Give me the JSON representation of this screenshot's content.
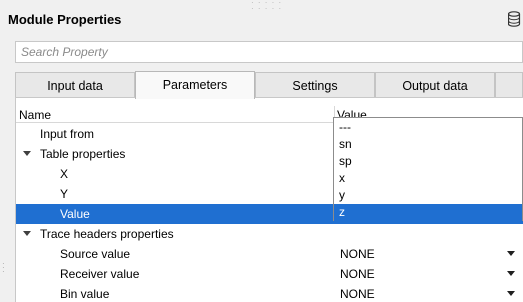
{
  "window": {
    "title": "Module Properties"
  },
  "search": {
    "placeholder": "Search Property"
  },
  "tabs": [
    {
      "label": "Input data"
    },
    {
      "label": "Parameters"
    },
    {
      "label": "Settings"
    },
    {
      "label": "Output data"
    },
    {
      "label": ""
    }
  ],
  "active_tab": "Parameters",
  "table": {
    "headers": {
      "name": "Name",
      "value": "Value"
    },
    "rows": [
      {
        "name": "Input from",
        "value": ""
      },
      {
        "name": "Table properties",
        "value": ""
      },
      {
        "name": "X",
        "value": ""
      },
      {
        "name": "Y",
        "value": ""
      },
      {
        "name": "Value",
        "value": ""
      },
      {
        "name": "Trace headers properties",
        "value": ""
      },
      {
        "name": "Source value",
        "value": "NONE"
      },
      {
        "name": "Receiver value",
        "value": "NONE"
      },
      {
        "name": "Bin value",
        "value": "NONE"
      }
    ]
  },
  "dropdown": {
    "options": [
      "---",
      "sn",
      "sp",
      "x",
      "y",
      "z"
    ],
    "selected": "z"
  },
  "colors": {
    "selection": "#1f6fd1"
  }
}
